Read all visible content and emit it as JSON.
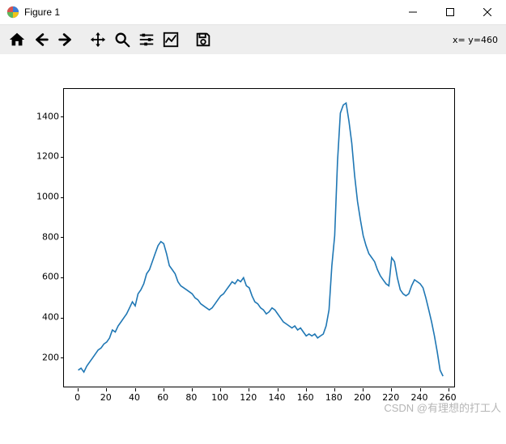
{
  "window": {
    "title": "Figure 1"
  },
  "toolbar": {
    "coord_text": "x=  y=460"
  },
  "watermark": "CSDN @有理想的打工人",
  "chart_data": {
    "type": "line",
    "xlabel": "",
    "ylabel": "",
    "title": "",
    "xlim": [
      -10,
      265
    ],
    "ylim": [
      50,
      1540
    ],
    "xticks": [
      0,
      20,
      40,
      60,
      80,
      100,
      120,
      140,
      160,
      180,
      200,
      220,
      240,
      260
    ],
    "yticks": [
      200,
      400,
      600,
      800,
      1000,
      1200,
      1400
    ],
    "x": [
      0,
      2,
      4,
      6,
      8,
      10,
      12,
      14,
      16,
      18,
      20,
      22,
      24,
      26,
      28,
      30,
      32,
      34,
      36,
      38,
      40,
      42,
      44,
      46,
      48,
      50,
      52,
      54,
      56,
      58,
      60,
      62,
      64,
      66,
      68,
      70,
      72,
      74,
      76,
      78,
      80,
      82,
      84,
      86,
      88,
      90,
      92,
      94,
      96,
      98,
      100,
      102,
      104,
      106,
      108,
      110,
      112,
      114,
      116,
      118,
      120,
      122,
      124,
      126,
      128,
      130,
      132,
      134,
      136,
      138,
      140,
      142,
      144,
      146,
      148,
      150,
      152,
      154,
      156,
      158,
      160,
      162,
      164,
      166,
      168,
      170,
      172,
      174,
      176,
      178,
      180,
      182,
      184,
      186,
      188,
      190,
      192,
      194,
      196,
      198,
      200,
      202,
      204,
      206,
      208,
      210,
      212,
      214,
      216,
      218,
      220,
      222,
      224,
      226,
      228,
      230,
      232,
      234,
      236,
      238,
      240,
      242,
      244,
      246,
      248,
      250,
      252,
      254,
      256
    ],
    "y": [
      140,
      150,
      130,
      160,
      180,
      200,
      220,
      240,
      250,
      270,
      280,
      300,
      340,
      330,
      360,
      380,
      400,
      420,
      450,
      480,
      460,
      520,
      540,
      570,
      620,
      640,
      680,
      720,
      760,
      780,
      770,
      720,
      660,
      640,
      620,
      580,
      560,
      550,
      540,
      530,
      520,
      500,
      490,
      470,
      460,
      450,
      440,
      450,
      470,
      490,
      510,
      520,
      540,
      560,
      580,
      570,
      590,
      580,
      600,
      560,
      550,
      510,
      480,
      470,
      450,
      440,
      420,
      430,
      450,
      440,
      420,
      400,
      380,
      370,
      360,
      350,
      360,
      340,
      350,
      330,
      310,
      320,
      310,
      320,
      300,
      310,
      320,
      360,
      440,
      660,
      810,
      1180,
      1420,
      1460,
      1470,
      1380,
      1270,
      1110,
      980,
      890,
      810,
      760,
      720,
      700,
      680,
      640,
      610,
      590,
      570,
      560,
      700,
      680,
      600,
      540,
      520,
      510,
      520,
      560,
      590,
      580,
      570,
      550,
      500,
      440,
      380,
      310,
      230,
      140,
      110
    ]
  }
}
